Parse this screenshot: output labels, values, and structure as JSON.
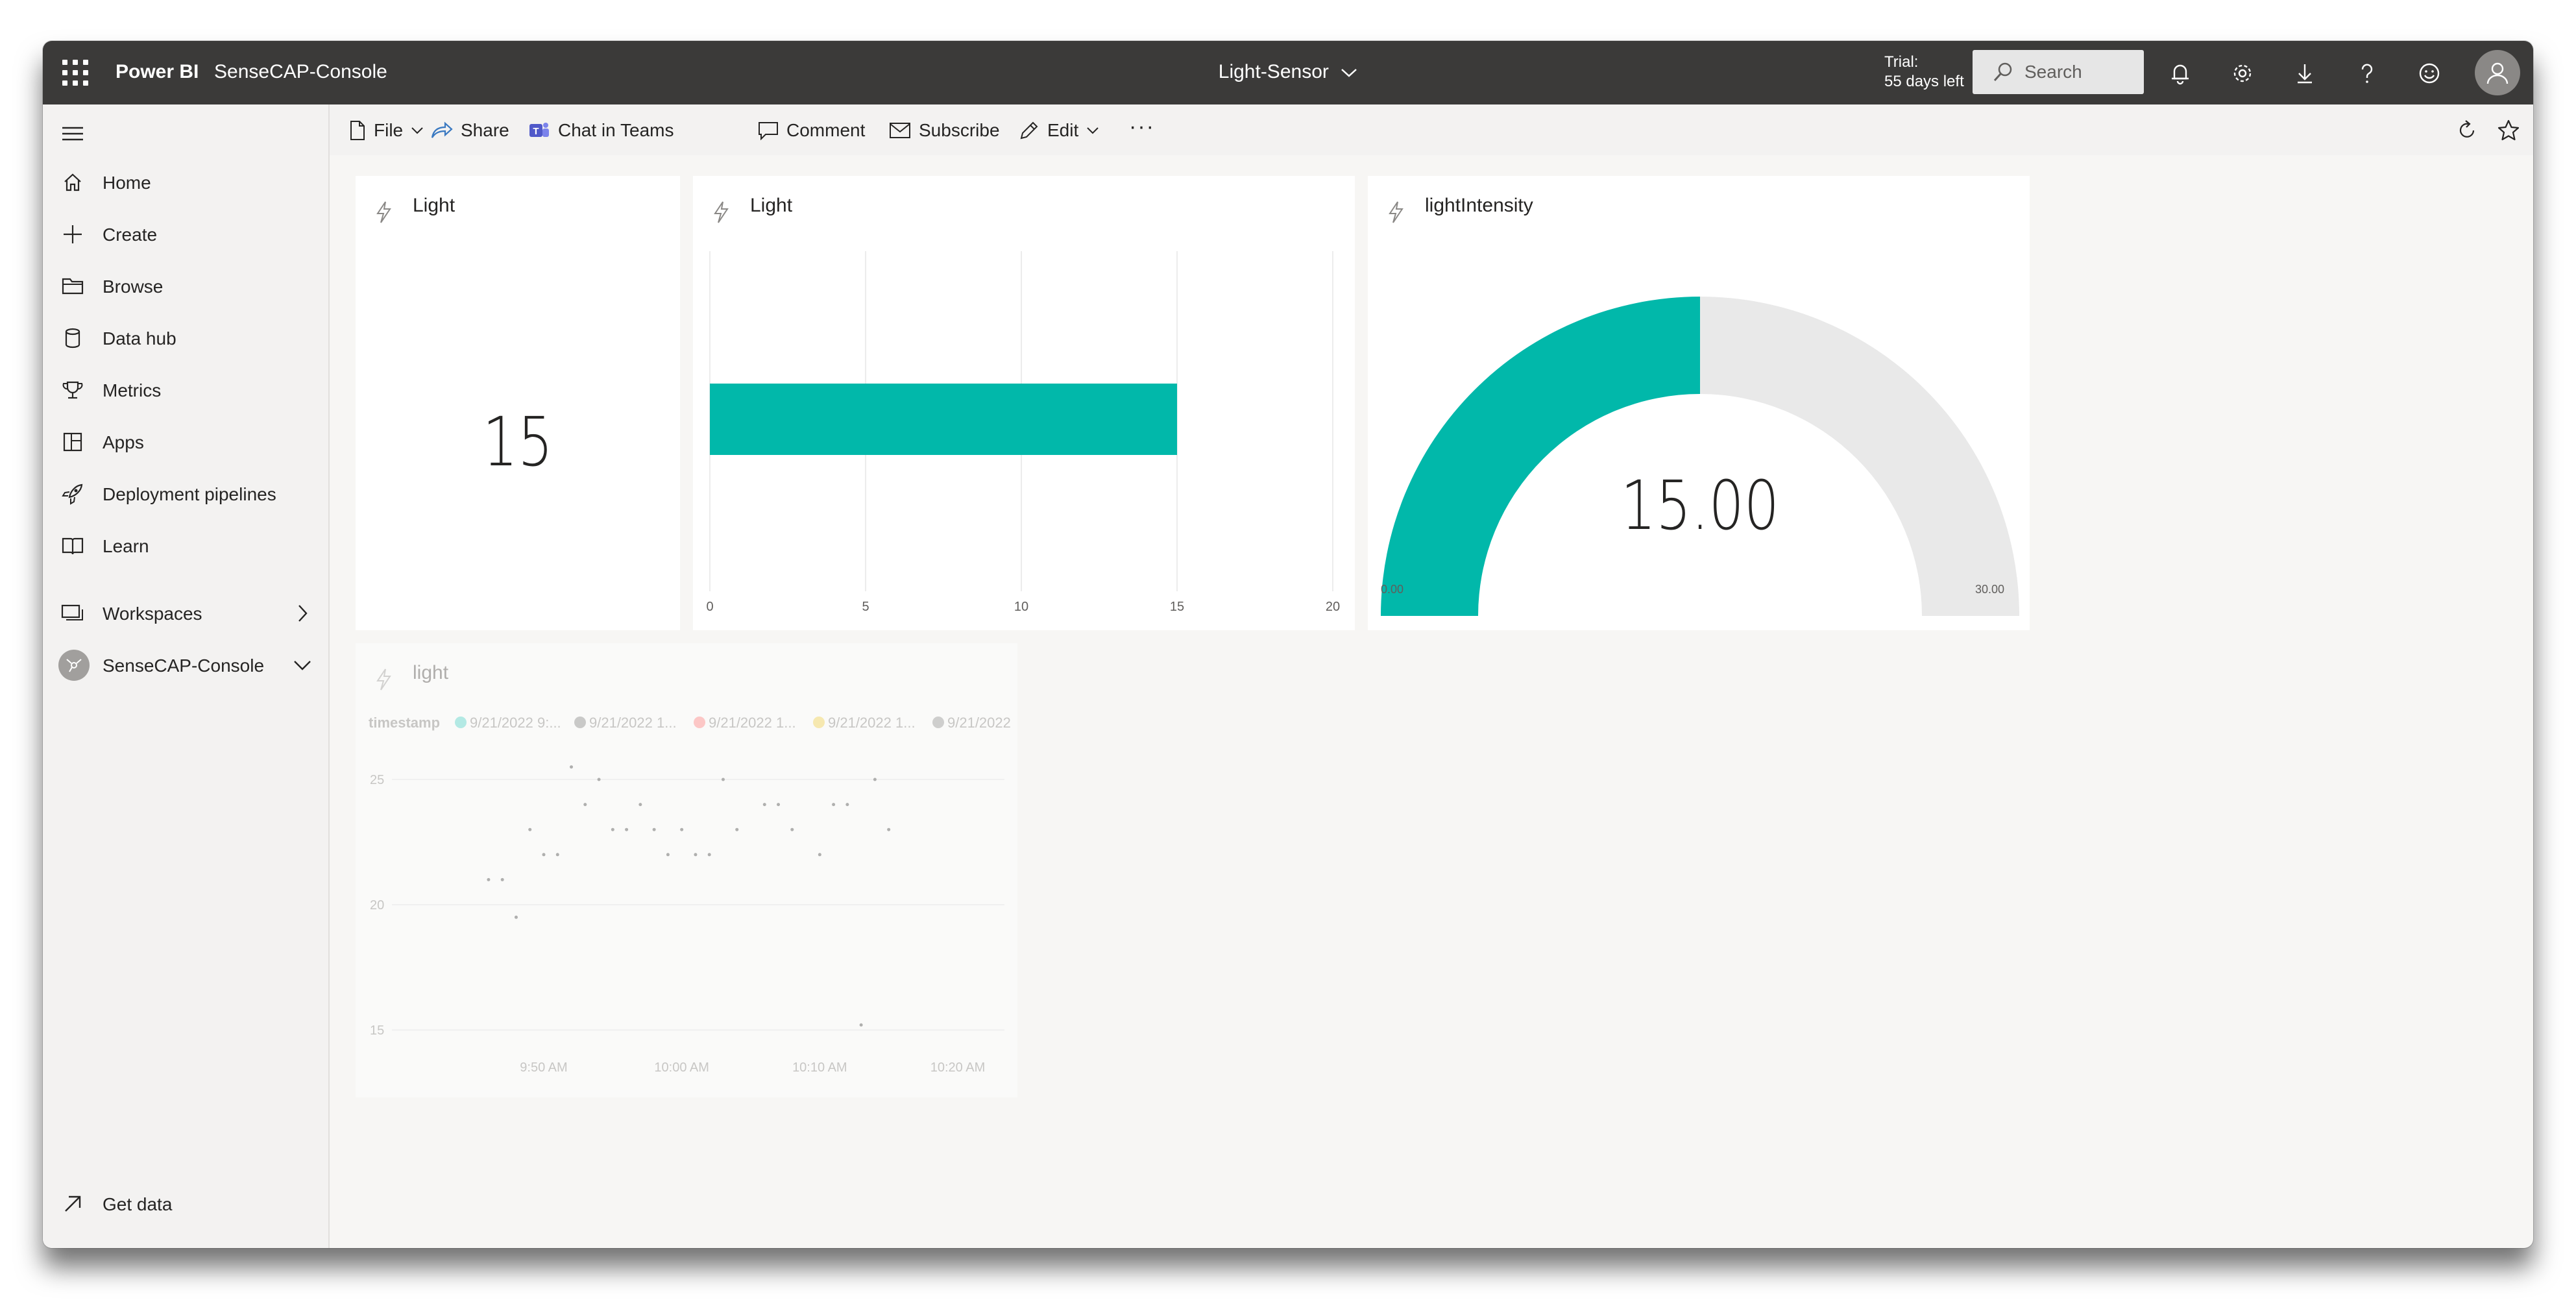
{
  "app": {
    "brand": "Power BI",
    "workspace": "SenseCAP-Console",
    "dashboard_title": "Light-Sensor",
    "trial_line1": "Trial:",
    "trial_line2": "55 days left",
    "search_placeholder": "Search"
  },
  "sidebar": {
    "items": [
      {
        "label": "Home",
        "icon": "home-icon"
      },
      {
        "label": "Create",
        "icon": "plus-icon"
      },
      {
        "label": "Browse",
        "icon": "folder-icon"
      },
      {
        "label": "Data hub",
        "icon": "cylinder-icon"
      },
      {
        "label": "Metrics",
        "icon": "trophy-icon"
      },
      {
        "label": "Apps",
        "icon": "apps-icon"
      },
      {
        "label": "Deployment pipelines",
        "icon": "rocket-icon"
      },
      {
        "label": "Learn",
        "icon": "book-icon"
      },
      {
        "label": "Workspaces",
        "icon": "workspaces-icon"
      },
      {
        "label": "SenseCAP-Console",
        "icon": "workspace-avatar-icon"
      }
    ],
    "get_data": "Get data"
  },
  "actionbar": {
    "file": "File",
    "share": "Share",
    "teams": "Chat in Teams",
    "comment": "Comment",
    "subscribe": "Subscribe",
    "edit": "Edit",
    "more": "···"
  },
  "tiles": {
    "card": {
      "title": "Light",
      "value": "15"
    },
    "bar": {
      "title": "Light"
    },
    "gauge": {
      "title": "lightIntensity",
      "value": "15.00",
      "min_label": "0.00",
      "max_label": "30.00"
    },
    "scatter": {
      "title": "light"
    }
  },
  "colors": {
    "accent": "#01b8aa",
    "topbar": "#3b3a39",
    "gauge_bg": "#e9e9e9"
  },
  "chart_data": [
    {
      "type": "bar",
      "title": "Light",
      "categories": [
        ""
      ],
      "values": [
        15
      ],
      "xlim": [
        0,
        20
      ],
      "xticks": [
        "0",
        "5",
        "10",
        "15",
        "20"
      ],
      "grid": true
    },
    {
      "type": "gauge",
      "title": "lightIntensity",
      "value": 15,
      "min": 0,
      "max": 30
    },
    {
      "type": "scatter",
      "title": "light",
      "legend_title": "timestamp",
      "legend": [
        {
          "name": "9/21/2022 9:...",
          "color": "#5ed6cc"
        },
        {
          "name": "9/21/2022 1...",
          "color": "#8e8e8e"
        },
        {
          "name": "9/21/2022 1...",
          "color": "#ff8a8a"
        },
        {
          "name": "9/21/2022 1...",
          "color": "#f2d35a"
        },
        {
          "name": "9/21/2022",
          "color": "#9a9a9a"
        }
      ],
      "yticks": [
        "15",
        "20",
        "25"
      ],
      "ylim": [
        15,
        25
      ],
      "xticks": [
        "9:50 AM",
        "10:00 AM",
        "10:10 AM",
        "10:20 AM"
      ],
      "points": [
        {
          "t": "9:46 AM",
          "y": 21
        },
        {
          "t": "9:47 AM",
          "y": 21
        },
        {
          "t": "9:48 AM",
          "y": 19.5
        },
        {
          "t": "9:49 AM",
          "y": 23
        },
        {
          "t": "9:50 AM",
          "y": 22
        },
        {
          "t": "9:51 AM",
          "y": 22
        },
        {
          "t": "9:52 AM",
          "y": 25.5
        },
        {
          "t": "9:53 AM",
          "y": 24
        },
        {
          "t": "9:54 AM",
          "y": 25
        },
        {
          "t": "9:55 AM",
          "y": 23
        },
        {
          "t": "9:56 AM",
          "y": 23
        },
        {
          "t": "9:57 AM",
          "y": 24
        },
        {
          "t": "9:58 AM",
          "y": 23
        },
        {
          "t": "9:59 AM",
          "y": 22
        },
        {
          "t": "10:00 AM",
          "y": 23
        },
        {
          "t": "10:01 AM",
          "y": 22
        },
        {
          "t": "10:02 AM",
          "y": 22
        },
        {
          "t": "10:03 AM",
          "y": 25
        },
        {
          "t": "10:04 AM",
          "y": 23
        },
        {
          "t": "10:06 AM",
          "y": 24
        },
        {
          "t": "10:07 AM",
          "y": 24
        },
        {
          "t": "10:08 AM",
          "y": 23
        },
        {
          "t": "10:10 AM",
          "y": 22
        },
        {
          "t": "10:11 AM",
          "y": 24
        },
        {
          "t": "10:12 AM",
          "y": 24
        },
        {
          "t": "10:13 AM",
          "y": 15.2
        },
        {
          "t": "10:14 AM",
          "y": 25
        },
        {
          "t": "10:15 AM",
          "y": 23
        }
      ]
    }
  ]
}
